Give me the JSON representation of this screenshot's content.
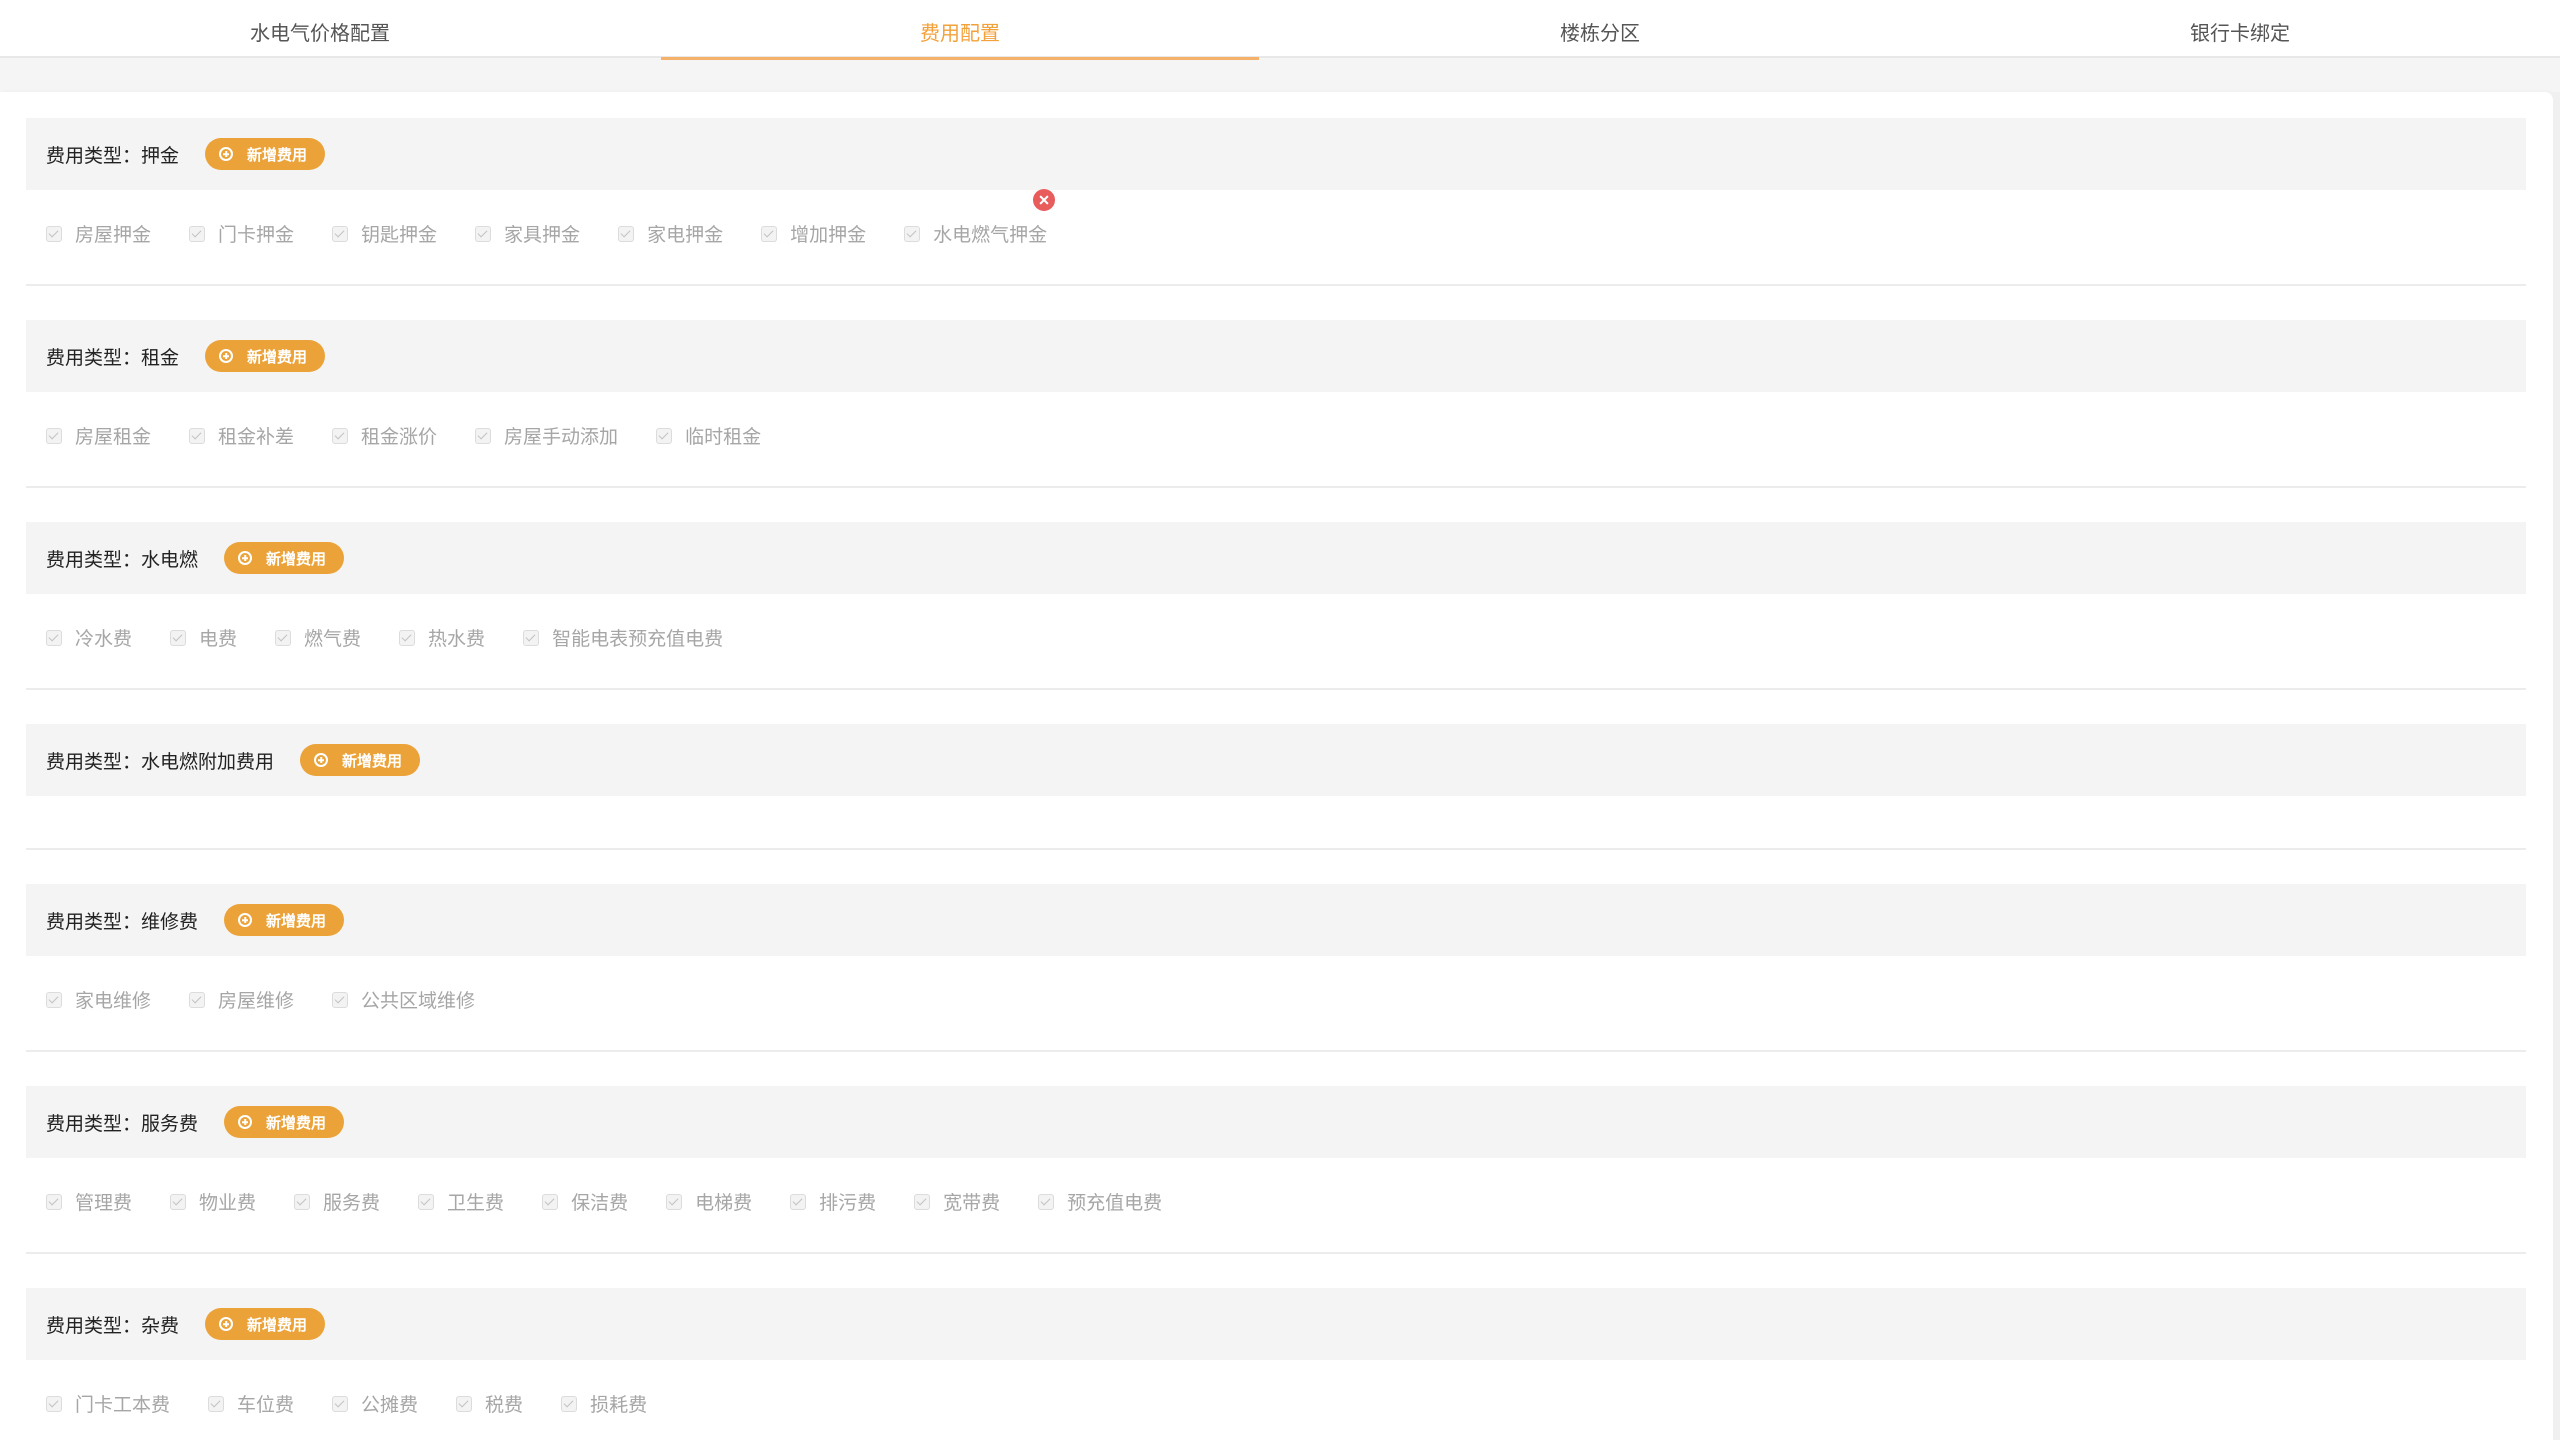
{
  "tabs": [
    {
      "label": "水电气价格配置",
      "active": false
    },
    {
      "label": "费用配置",
      "active": true
    },
    {
      "label": "楼栋分区",
      "active": false
    },
    {
      "label": "银行卡绑定",
      "active": false
    }
  ],
  "add_button_label": "新增费用",
  "groups": [
    {
      "title": "费用类型：押金",
      "items": [
        "房屋押金",
        "门卡押金",
        "钥匙押金",
        "家具押金",
        "家电押金",
        "增加押金",
        "水电燃气押金"
      ]
    },
    {
      "title": "费用类型：租金",
      "items": [
        "房屋租金",
        "租金补差",
        "租金涨价",
        "房屋手动添加",
        "临时租金"
      ]
    },
    {
      "title": "费用类型：水电燃",
      "items": [
        "冷水费",
        "电费",
        "燃气费",
        "热水费",
        "智能电表预充值电费"
      ]
    },
    {
      "title": "费用类型：水电燃附加费用",
      "items": []
    },
    {
      "title": "费用类型：维修费",
      "items": [
        "家电维修",
        "房屋维修",
        "公共区域维修"
      ]
    },
    {
      "title": "费用类型：服务费",
      "items": [
        "管理费",
        "物业费",
        "服务费",
        "卫生费",
        "保洁费",
        "电梯费",
        "排污费",
        "宽带费",
        "预充值电费"
      ]
    },
    {
      "title": "费用类型：杂费",
      "items": [
        "门卡工本费",
        "车位费",
        "公摊费",
        "税费",
        "损耗费"
      ]
    }
  ],
  "colors": {
    "accent": "#f3a13a",
    "button": "#eba339",
    "delete": "#e85c5c"
  }
}
